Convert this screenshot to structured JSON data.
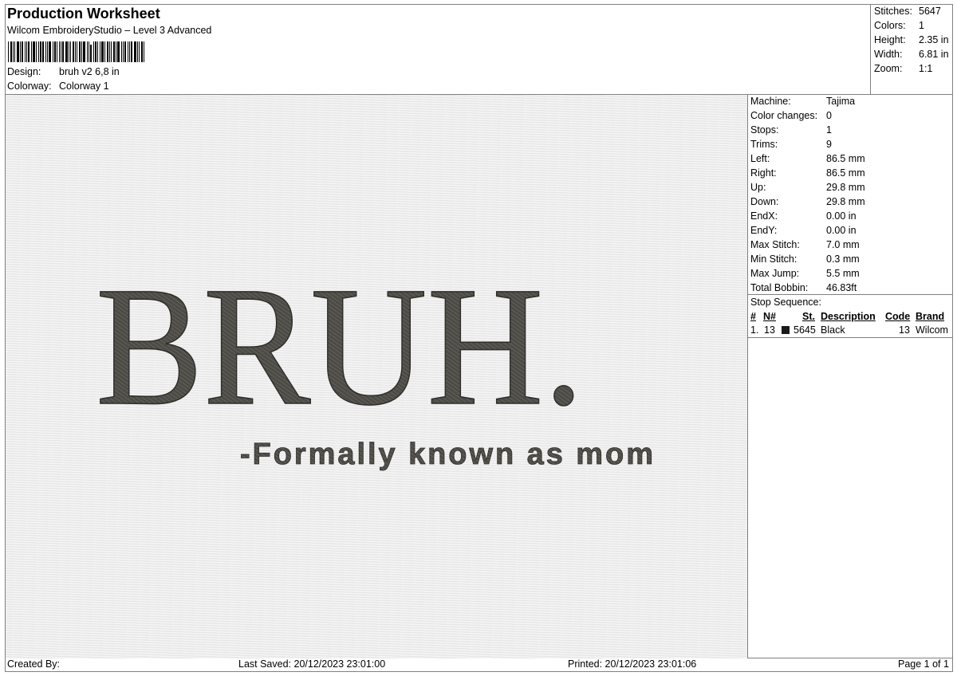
{
  "header": {
    "title": "Production Worksheet",
    "subtitle": "Wilcom EmbroideryStudio – Level 3 Advanced",
    "design_label": "Design:",
    "design_value": "bruh v2 6,8 in",
    "colorway_label": "Colorway:",
    "colorway_value": "Colorway 1"
  },
  "stats": [
    {
      "label": "Stitches:",
      "value": "5647"
    },
    {
      "label": "Colors:",
      "value": "1"
    },
    {
      "label": "Height:",
      "value": "2.35 in"
    },
    {
      "label": "Width:",
      "value": "6.81 in"
    },
    {
      "label": "Zoom:",
      "value": "1:1"
    }
  ],
  "machine_info": [
    {
      "label": "Machine:",
      "value": "Tajima"
    },
    {
      "label": "Color changes:",
      "value": "0"
    },
    {
      "label": "Stops:",
      "value": "1"
    },
    {
      "label": "Trims:",
      "value": "9"
    },
    {
      "label": "Left:",
      "value": "86.5 mm"
    },
    {
      "label": "Right:",
      "value": "86.5 mm"
    },
    {
      "label": "Up:",
      "value": "29.8 mm"
    },
    {
      "label": "Down:",
      "value": "29.8 mm"
    },
    {
      "label": "EndX:",
      "value": "0.00 in"
    },
    {
      "label": "EndY:",
      "value": "0.00 in"
    },
    {
      "label": "Max Stitch:",
      "value": "7.0 mm"
    },
    {
      "label": "Min Stitch:",
      "value": "0.3 mm"
    },
    {
      "label": "Max Jump:",
      "value": "5.5 mm"
    },
    {
      "label": "Total Bobbin:",
      "value": "46.83ft"
    }
  ],
  "stop_sequence": {
    "title": "Stop Sequence:",
    "headers": {
      "num": "#",
      "n": "N#",
      "st": "St.",
      "description": "Description",
      "code": "Code",
      "brand": "Brand"
    },
    "rows": [
      {
        "num": "1.",
        "n": "13",
        "swatch_color": "#1a1a1a",
        "st": "5645",
        "description": "Black",
        "code": "13",
        "brand": "Wilcom"
      }
    ]
  },
  "design_text": {
    "main": "BRUH.",
    "sub": "-Formally known as mom",
    "thread_color": "#4a4944"
  },
  "footer": {
    "created_by": "Created By:",
    "last_saved": "Last Saved: 20/12/2023 23:01:00",
    "printed": "Printed: 20/12/2023 23:01:06",
    "page": "Page 1 of 1"
  }
}
